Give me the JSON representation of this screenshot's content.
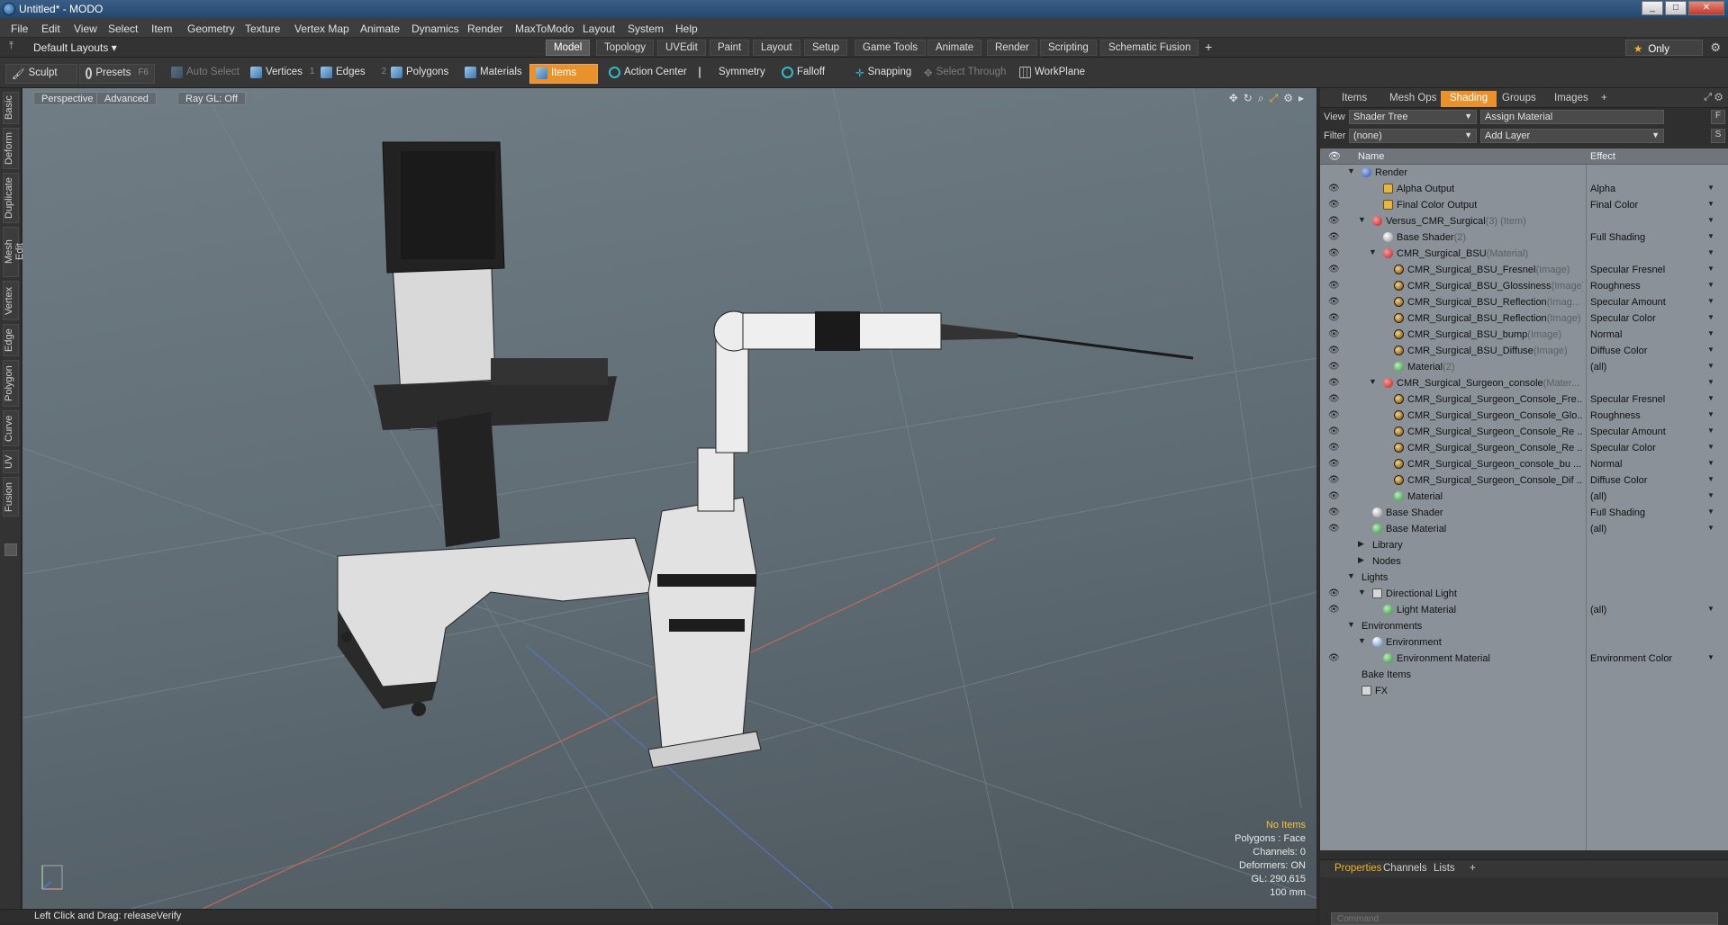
{
  "title": "Untitled* - MODO",
  "window_buttons": [
    "_",
    "□",
    "✕"
  ],
  "menu": [
    "File",
    "Edit",
    "View",
    "Select",
    "Item",
    "Geometry",
    "Texture",
    "Vertex Map",
    "Animate",
    "Dynamics",
    "Render",
    "MaxToModo",
    "Layout",
    "System",
    "Help"
  ],
  "layout_selector": "Default Layouts ▾",
  "layout_tabs": [
    {
      "label": "Model",
      "active": true
    },
    {
      "label": "Topology"
    },
    {
      "label": "UVEdit"
    },
    {
      "label": "Paint"
    },
    {
      "label": "Layout"
    },
    {
      "label": "Setup"
    },
    {
      "label": "Game Tools"
    },
    {
      "label": "Animate"
    },
    {
      "label": "Render"
    },
    {
      "label": "Scripting"
    },
    {
      "label": "Schematic Fusion"
    },
    {
      "label": "+"
    }
  ],
  "only_label": "Only",
  "toolbar": {
    "sculpt": "Sculpt",
    "presets": "Presets",
    "presets_key": "F6",
    "auto_select": "Auto Select",
    "vertices": "Vertices",
    "vertices_key": "1",
    "edges": "Edges",
    "edges_key": "2",
    "polygons": "Polygons",
    "materials": "Materials",
    "items": "Items",
    "action_center": "Action Center",
    "symmetry": "Symmetry",
    "falloff": "Falloff",
    "snapping": "Snapping",
    "select_through": "Select Through",
    "workplane": "WorkPlane"
  },
  "left_tabs": [
    "Basic",
    "Deform",
    "Duplicate",
    "Mesh Edit",
    "Vertex",
    "Edge",
    "Polygon",
    "Curve",
    "UV",
    "Fusion"
  ],
  "viewport": {
    "view_mode": "Perspective",
    "advanced": "Advanced",
    "raygl": "Ray GL: Off",
    "hud": {
      "selection": "No Items",
      "polygons": "Polygons : Face",
      "channels": "Channels: 0",
      "deformers": "Deformers: ON",
      "gl": "GL: 290,615",
      "scale": "100 mm"
    }
  },
  "right_tabs": [
    "Items",
    "Mesh Ops",
    "Shading",
    "Groups",
    "Images",
    "+"
  ],
  "shading": {
    "view_label": "View",
    "view_value": "Shader Tree",
    "assign_material": "Assign Material",
    "f_button": "F",
    "filter_label": "Filter",
    "filter_value": "(none)",
    "add_layer": "Add Layer",
    "s_button": "S",
    "col_name": "Name",
    "col_effect": "Effect"
  },
  "tree_rows": [
    {
      "name": "Render",
      "tag": "",
      "effect": "",
      "indent": 0,
      "icon": "blue",
      "eye": false,
      "twist": "▼"
    },
    {
      "name": "Alpha Output",
      "tag": "",
      "effect": "Alpha",
      "indent": 2,
      "icon": "out",
      "eye": true
    },
    {
      "name": "Final Color Output",
      "tag": "",
      "effect": "Final Color",
      "indent": 2,
      "icon": "out",
      "eye": true
    },
    {
      "name": "Versus_CMR_Surgical",
      "tag": " (3) (Item)",
      "effect": "",
      "indent": 1,
      "icon": "red",
      "eye": true,
      "twist": "▼"
    },
    {
      "name": "Base Shader",
      "tag": " (2)",
      "effect": "Full Shading",
      "indent": 2,
      "icon": "gray",
      "eye": true
    },
    {
      "name": "CMR_Surgical_BSU",
      "tag": " (Material)",
      "effect": "",
      "indent": 2,
      "icon": "red",
      "eye": true,
      "twist": "▼"
    },
    {
      "name": "CMR_Surgical_BSU_Fresnel",
      "tag": " (Image)",
      "effect": "Specular Fresnel",
      "indent": 3,
      "icon": "img",
      "eye": true
    },
    {
      "name": "CMR_Surgical_BSU_Glossiness",
      "tag": " (Image)",
      "effect": "Roughness",
      "indent": 3,
      "icon": "img",
      "eye": true
    },
    {
      "name": "CMR_Surgical_BSU_Reflection",
      "tag": " (Imag...",
      "effect": "Specular Amount",
      "indent": 3,
      "icon": "img",
      "eye": true
    },
    {
      "name": "CMR_Surgical_BSU_Reflection",
      "tag": " (Image)",
      "effect": "Specular Color",
      "indent": 3,
      "icon": "img",
      "eye": true
    },
    {
      "name": "CMR_Surgical_BSU_bump",
      "tag": " (Image)",
      "effect": "Normal",
      "indent": 3,
      "icon": "img",
      "eye": true
    },
    {
      "name": "CMR_Surgical_BSU_Diffuse",
      "tag": " (Image)",
      "effect": "Diffuse Color",
      "indent": 3,
      "icon": "img",
      "eye": true
    },
    {
      "name": "Material",
      "tag": " (2)",
      "effect": "(all)",
      "indent": 3,
      "icon": "green",
      "eye": true
    },
    {
      "name": "CMR_Surgical_Surgeon_console",
      "tag": " (Mater...",
      "effect": "",
      "indent": 2,
      "icon": "red",
      "eye": true,
      "twist": "▼"
    },
    {
      "name": "CMR_Surgical_Surgeon_Console_Fre...",
      "tag": "",
      "effect": "Specular Fresnel",
      "indent": 3,
      "icon": "img",
      "eye": true
    },
    {
      "name": "CMR_Surgical_Surgeon_Console_Glo...",
      "tag": "",
      "effect": "Roughness",
      "indent": 3,
      "icon": "img",
      "eye": true
    },
    {
      "name": "CMR_Surgical_Surgeon_Console_Re ...",
      "tag": "",
      "effect": "Specular Amount",
      "indent": 3,
      "icon": "img",
      "eye": true
    },
    {
      "name": "CMR_Surgical_Surgeon_Console_Re ...",
      "tag": "",
      "effect": "Specular Color",
      "indent": 3,
      "icon": "img",
      "eye": true
    },
    {
      "name": "CMR_Surgical_Surgeon_console_bu ...",
      "tag": "",
      "effect": "Normal",
      "indent": 3,
      "icon": "img",
      "eye": true
    },
    {
      "name": "CMR_Surgical_Surgeon_Console_Dif ...",
      "tag": "",
      "effect": "Diffuse Color",
      "indent": 3,
      "icon": "img",
      "eye": true
    },
    {
      "name": "Material",
      "tag": "",
      "effect": "(all)",
      "indent": 3,
      "icon": "green",
      "eye": true
    },
    {
      "name": "Base Shader",
      "tag": "",
      "effect": "Full Shading",
      "indent": 1,
      "icon": "gray",
      "eye": true
    },
    {
      "name": "Base Material",
      "tag": "",
      "effect": "(all)",
      "indent": 1,
      "icon": "green",
      "eye": true
    },
    {
      "name": "Library",
      "tag": "",
      "effect": "",
      "indent": 1,
      "icon": "",
      "eye": false,
      "twist": "▶"
    },
    {
      "name": "Nodes",
      "tag": "",
      "effect": "",
      "indent": 1,
      "icon": "",
      "eye": false,
      "twist": "▶"
    },
    {
      "name": "Lights",
      "tag": "",
      "effect": "",
      "indent": 0,
      "icon": "",
      "eye": false,
      "twist": "▼"
    },
    {
      "name": "Directional Light",
      "tag": "",
      "effect": "",
      "indent": 1,
      "icon": "folder",
      "eye": true,
      "twist": "▼"
    },
    {
      "name": "Light Material",
      "tag": "",
      "effect": "(all)",
      "indent": 2,
      "icon": "green",
      "eye": true
    },
    {
      "name": "Environments",
      "tag": "",
      "effect": "",
      "indent": 0,
      "icon": "",
      "eye": false,
      "twist": "▼"
    },
    {
      "name": "Environment",
      "tag": "",
      "effect": "",
      "indent": 1,
      "icon": "env",
      "eye": false,
      "twist": "▼"
    },
    {
      "name": "Environment Material",
      "tag": "",
      "effect": "Environment Color",
      "indent": 2,
      "icon": "green",
      "eye": true
    },
    {
      "name": "Bake Items",
      "tag": "",
      "effect": "",
      "indent": 0,
      "icon": "",
      "eye": false
    },
    {
      "name": "FX",
      "tag": "",
      "effect": "",
      "indent": 0,
      "icon": "folder",
      "eye": false
    }
  ],
  "bottom_tabs": [
    "Properties",
    "Channels",
    "Lists",
    "+"
  ],
  "command_placeholder": "Command",
  "status": "Left Click and Drag:  releaseVerify",
  "colors": {
    "accent": "#e8912d",
    "viewport": "#66737b",
    "tree_bg": "#8b9198",
    "hud_highlight": "#f5c243"
  }
}
